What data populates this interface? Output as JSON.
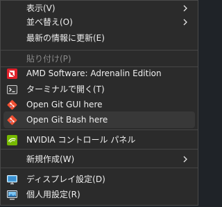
{
  "context_menu": {
    "items": [
      {
        "label": "表示(V)",
        "has_submenu": true
      },
      {
        "label": "並べ替え(O)",
        "has_submenu": true
      },
      {
        "label": "最新の情報に更新(E)"
      },
      {
        "label": "貼り付け(P)",
        "disabled": true
      },
      {
        "label": "AMD Software: Adrenalin Edition",
        "icon": "amd-icon"
      },
      {
        "label": "ターミナルで開く(T)",
        "icon": "terminal-icon"
      },
      {
        "label": "Open Git GUI here",
        "icon": "git-icon"
      },
      {
        "label": "Open Git Bash here",
        "icon": "git-icon",
        "hovered": true
      },
      {
        "label": "NVIDIA コントロール パネル",
        "icon": "nvidia-icon"
      },
      {
        "label": "新規作成(W)",
        "has_submenu": true
      },
      {
        "label": "ディスプレイ設定(D)",
        "icon": "display-icon"
      },
      {
        "label": "個人用設定(R)",
        "icon": "personalize-icon"
      }
    ]
  },
  "colors": {
    "menu_background": "#2b2b2b",
    "hover_background": "#383838",
    "text": "#f0f0f0",
    "disabled_text": "#8a8a8a",
    "amd_red": "#e0202a",
    "git_orange": "#f05033",
    "nvidia_green": "#76b900"
  }
}
